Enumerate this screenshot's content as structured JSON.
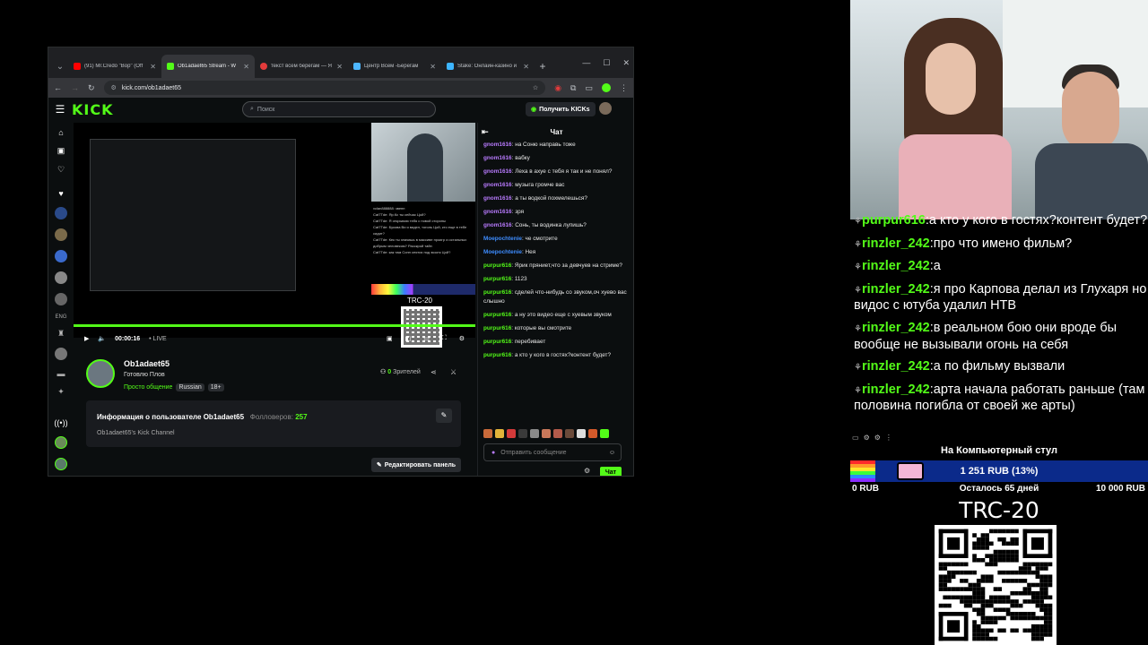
{
  "browser": {
    "tabs": [
      {
        "label": "(91) Mr.Credo \"Вор\" (Off",
        "favicon_color": "#ff0000",
        "active": false
      },
      {
        "label": "Ob1adaet65 Stream - W",
        "favicon_color": "#53fc18",
        "active": true
      },
      {
        "label": "текст всем берегам — Я",
        "favicon_color": "#e33b3b",
        "active": false
      },
      {
        "label": "Центр Всем -Берегам",
        "favicon_color": "#4db6ff",
        "active": false
      },
      {
        "label": "Stake: Онлайн-казино и",
        "favicon_color": "#3db5ff",
        "active": false
      }
    ],
    "url": "kick.com/ob1adaet65"
  },
  "kick": {
    "logo": "KICK",
    "search_placeholder": "Поиск",
    "get_kicks": "Получить KICKs",
    "player": {
      "time": "00:00:16",
      "live": "LIVE",
      "mini_trc": "TRC-20",
      "mini_chat": [
        "vclan888888:  звенп",
        "Cat7Tde: Яр.Кс ты сейчас Цой?",
        "Cat7Tde: Я открываю тебя с новой стороны",
        "Cat7Tde: Букова Ви я видел, тоголь Цой, кто еще в тебе сидит?",
        "Cat7Tde: Кек ты значишь в массиве проигр и остальных добрым человеком? Расскрой тайн",
        "Cat7Tde: как там Сонн сеятся под экзотк Цой?"
      ]
    },
    "streamer": {
      "name": "Ob1adaet65",
      "title": "Готовлю Плов",
      "category": "Просто общение",
      "tags": [
        "Russian",
        "18+"
      ],
      "viewers": "0",
      "viewers_label": "Зрителей"
    },
    "about": {
      "heading": "Информация о пользователе Ob1adaet65",
      "followers_label": "Фолловеров:",
      "followers": "257",
      "description": "Ob1adaet65's Kick Channel"
    },
    "edit_panel": "Редактировать панель",
    "chat": {
      "title": "Чат",
      "messages": [
        {
          "user": "gnom1616",
          "color": "gnom",
          "text": "на Соню направь тоже"
        },
        {
          "user": "gnom1616",
          "color": "gnom",
          "text": "вабку"
        },
        {
          "user": "gnom1616",
          "color": "gnom",
          "text": "Леха в ахуе с тебя я так и не понял?"
        },
        {
          "user": "gnom1616",
          "color": "gnom",
          "text": "музыга громче вас"
        },
        {
          "user": "gnom1616",
          "color": "gnom",
          "text": "а ты водкой похмелешься?"
        },
        {
          "user": "gnom1616",
          "color": "gnom",
          "text": "зря"
        },
        {
          "user": "gnom1616",
          "color": "gnom",
          "text": "Сонь, ты водинка лупишь?"
        },
        {
          "user": "Moepochtenie",
          "color": "moe",
          "text": "че смотрите"
        },
        {
          "user": "Moepochtenie",
          "color": "moe",
          "text": "Нея"
        },
        {
          "user": "purpur616",
          "color": "purp",
          "text": "Ярик пряниет,что за девчуев на стриме?"
        },
        {
          "user": "purpur616",
          "color": "purp",
          "text": "1123"
        },
        {
          "user": "purpur616",
          "color": "purp",
          "text": "сделей что-нибудь со звуком,оч хуево вас слышно"
        },
        {
          "user": "purpur616",
          "color": "purp",
          "text": "а ну это видео еще с хуевым звуком"
        },
        {
          "user": "purpur616",
          "color": "purp",
          "text": "которые вы смотрите"
        },
        {
          "user": "purpur616",
          "color": "purp",
          "text": "перебивает"
        },
        {
          "user": "purpur616",
          "color": "purp",
          "text": "а кто у кого в гостях?контент будет?"
        }
      ],
      "input_placeholder": "Отправить сообщение",
      "send_label": "Чат"
    }
  },
  "overlay": {
    "chat": [
      {
        "user": "purpur616",
        "text": "а кто у кого в гостях?контент будет?"
      },
      {
        "user": "rinzler_242",
        "text": "про что имено фильм?"
      },
      {
        "user": "rinzler_242",
        "text": "а"
      },
      {
        "user": "rinzler_242",
        "text": "я про Карпова делал из Глухаря но видос с ютуба удалил НТВ"
      },
      {
        "user": "rinzler_242",
        "text": "в реальном бою они вроде бы вообще не вызывали огонь на себя"
      },
      {
        "user": "rinzler_242",
        "text": "а по фильму вызвали"
      },
      {
        "user": "rinzler_242",
        "text": "арта начала работать раньше (там половина погибла от своей же арты)"
      }
    ],
    "goal": {
      "title": "На Компьютерный стул",
      "current": "1 251 RUB (13%)",
      "progress_fraction": 0.13,
      "min": "0 RUB",
      "remaining": "Осталось 65 дней",
      "max": "10 000 RUB"
    },
    "trc": "TRC-20"
  }
}
